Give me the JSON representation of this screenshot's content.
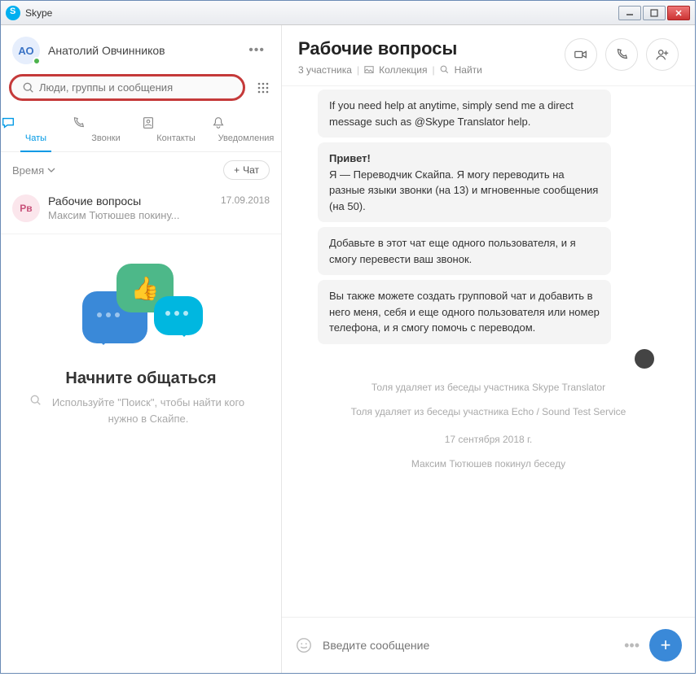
{
  "window": {
    "title": "Skype"
  },
  "profile": {
    "initials": "АО",
    "name": "Анатолий Овчинников"
  },
  "search": {
    "placeholder": "Люди, группы и сообщения"
  },
  "tabs": {
    "chats": "Чаты",
    "calls": "Звонки",
    "contacts": "Контакты",
    "notifications": "Уведомления"
  },
  "filter": {
    "sort": "Время",
    "new_chat": "Чат"
  },
  "chat_item": {
    "initials": "Рв",
    "title": "Рабочие вопросы",
    "date": "17.09.2018",
    "preview": "Максим Тютюшев покину..."
  },
  "empty": {
    "title": "Начните общаться",
    "subtitle": "Используйте \"Поиск\", чтобы найти кого нужно в Скайпе."
  },
  "chat": {
    "title": "Рабочие вопросы",
    "participants": "3 участника",
    "collection": "Коллекция",
    "find": "Найти"
  },
  "messages": {
    "m0": "If you need help at anytime, simply send me a direct message such as @Skype Translator help.",
    "m1_title": "Привет!",
    "m1": "Я — Переводчик Скайпа. Я могу переводить на разные языки звонки (на 13) и мгновенные сообщения (на 50).",
    "m2": "Добавьте в этот чат еще одного пользователя, и я смогу перевести ваш звонок.",
    "m3": "Вы также можете создать групповой чат и добавить в него меня, себя и еще одного пользователя или номер телефона, и я смогу помочь с переводом."
  },
  "system": {
    "s1": "Толя удаляет из беседы участника Skype Translator",
    "s2": "Толя удаляет из беседы участника Echo / Sound Test Service",
    "date": "17 сентября 2018 г.",
    "s3": "Максим Тютюшев покинул беседу"
  },
  "composer": {
    "placeholder": "Введите сообщение"
  }
}
